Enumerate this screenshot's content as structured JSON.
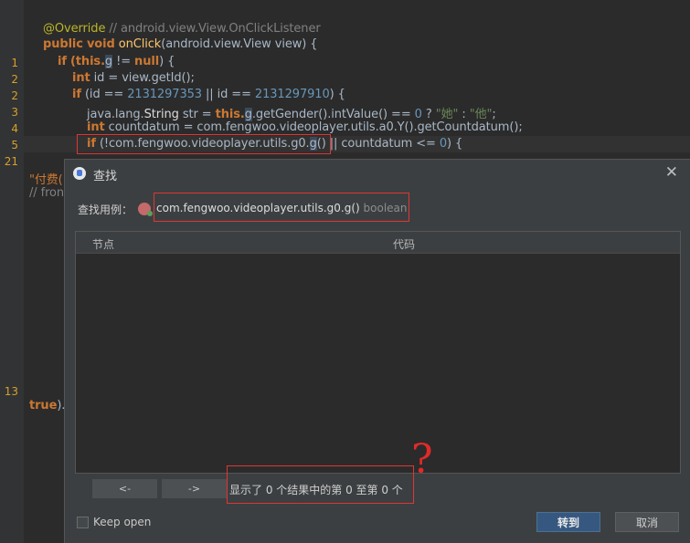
{
  "editor": {
    "gutter_numbers": [
      "1",
      "2",
      "2",
      "3",
      "4",
      "5",
      "21",
      "13"
    ],
    "lines": {
      "l0_annotation": "@Override",
      "l0_comment": "// android.view.View.OnClickListener",
      "l1_public": "public",
      "l1_void": "void",
      "l1_name": "onClick",
      "l1_rest": "(android.view.View view) {",
      "l2_if": "if",
      "l2_this": "(this.",
      "l2_sel": "g",
      "l2_rest": " != ",
      "l2_null": "null",
      "l2_end": ") {",
      "l3_int": "int",
      "l3_rest": " id = view.getId();",
      "l4_if": "if",
      "l4_a": " (id == ",
      "l4_n1": "2131297353",
      "l4_b": " || id == ",
      "l4_n2": "2131297910",
      "l4_c": ") {",
      "l5_a": "java.lang.",
      "l5_string": "String",
      "l5_b": " str = ",
      "l5_this": "this.",
      "l5_sel": "g",
      "l5_c": ".getGender().intValue() == ",
      "l5_zero": "0",
      "l5_q": " ? ",
      "l5_s1": "\"她\"",
      "l5_colon": " : ",
      "l5_s2": "\"他\"",
      "l5_end": ";",
      "l6_int": "int",
      "l6_rest": " countdatum = com.fengwoo.videoplayer.utils.a0.Y().getCountdatum();",
      "l7_if": "if",
      "l7_a": " (!com.fengwoo.videoplayer.utils.g0.",
      "l7_sel": "g",
      "l7_b": "() || countdatum <= ",
      "l7_zero": "0",
      "l7_c": ") {",
      "l8_partial": "\"付费(",
      "l9_partial": "// fron",
      "l10_true": "true",
      "l10_rest": ")."
    }
  },
  "dialog": {
    "title": "查找",
    "close_glyph": "✕",
    "usage_label": "查找用例：",
    "usage_target": "com.fengwoo.videoplayer.utils.g0.g()",
    "usage_type": "boolean",
    "table_columns": [
      "节点",
      "代码"
    ],
    "prev_label": "<-",
    "next_label": "->",
    "results_text": "显示了 0 个结果中的第 0 至第 0 个",
    "keep_open_label": "Keep open",
    "keep_open_checked": false,
    "goto_label": "转到",
    "cancel_label": "取消"
  },
  "annotation": {
    "question_mark": "?"
  },
  "colors": {
    "accent_button": "#365880",
    "highlight_box": "#e03535"
  }
}
